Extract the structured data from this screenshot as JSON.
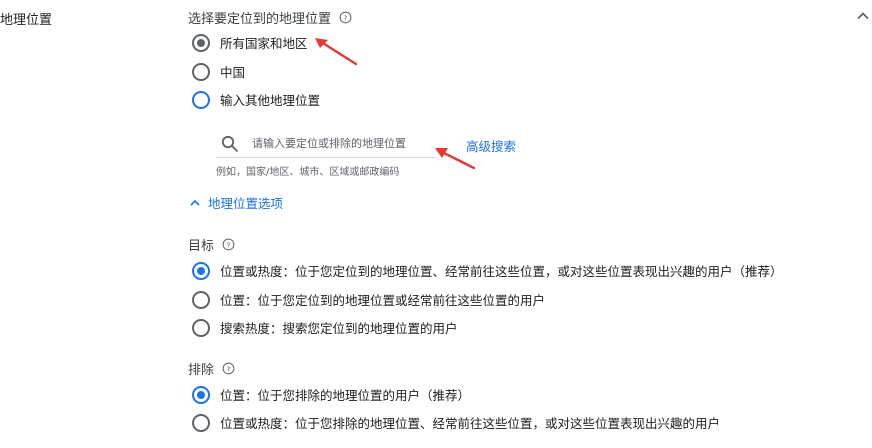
{
  "section": {
    "title": "地理位置"
  },
  "location": {
    "label": "选择要定位到的地理位置",
    "options": [
      {
        "label": "所有国家和地区",
        "selected": true
      },
      {
        "label": "中国",
        "selected": false
      },
      {
        "label": "输入其他地理位置",
        "selected": false
      }
    ]
  },
  "search": {
    "placeholder": "请输入要定位或排除的地理位置",
    "hint": "例如，国家/地区、城市、区域或邮政编码",
    "advanced_label": "高级搜索"
  },
  "location_options": {
    "toggle_label": "地理位置选项"
  },
  "target": {
    "label": "目标",
    "options": [
      {
        "label": "位置或热度：位于您定位到的地理位置、经常前往这些位置，或对这些位置表现出兴趣的用户（推荐）",
        "selected": true
      },
      {
        "label": "位置：位于您定位到的地理位置或经常前往这些位置的用户",
        "selected": false
      },
      {
        "label": "搜索热度：搜索您定位到的地理位置的用户",
        "selected": false
      }
    ]
  },
  "exclude": {
    "label": "排除",
    "options": [
      {
        "label": "位置：位于您排除的地理位置的用户（推荐）",
        "selected": true
      },
      {
        "label": "位置或热度：位于您排除的地理位置、经常前往这些位置，或对这些位置表现出兴趣的用户",
        "selected": false
      }
    ]
  },
  "colors": {
    "accent": "#1a73e8",
    "annotation_arrow": "#e53935",
    "text_primary": "#202124",
    "text_secondary": "#5f6368"
  },
  "icons": {
    "help": "help-circle-icon",
    "search": "search-icon",
    "collapse": "chevron-up-icon",
    "options_toggle": "chevron-up-icon"
  }
}
